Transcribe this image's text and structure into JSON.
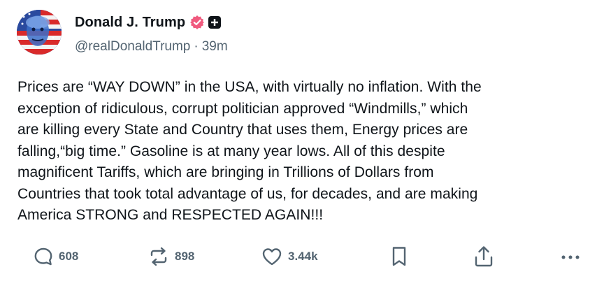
{
  "author": {
    "display_name": "Donald J. Trump",
    "handle": "@realDonaldTrump",
    "separator": "·",
    "time_ago": "39m",
    "verified_icon": "verified-badge-icon",
    "affiliation_icon": "plus-badge-icon"
  },
  "post": {
    "text": "Prices are “WAY DOWN” in the USA, with virtually no inflation. With the\nexception of ridiculous, corrupt politician approved “Windmills,” which\nare killing every State and Country that uses them, Energy prices are\nfalling,“big time.” Gasoline is at many year lows. All of this despite\nmagnificent Tariffs, which are bringing in Trillions of Dollars from\nCountries that took total advantage of us, for decades, and are making\nAmerica STRONG and RESPECTED AGAIN!!!"
  },
  "actions": {
    "reply_count": "608",
    "repost_count": "898",
    "like_count": "3.44k",
    "icons": [
      "reply-icon",
      "repost-icon",
      "like-icon",
      "bookmark-icon",
      "share-icon",
      "more-icon"
    ]
  },
  "colors": {
    "text": "#0f1419",
    "muted": "#536471",
    "verified": "#f05a7e",
    "background": "#ffffff"
  }
}
